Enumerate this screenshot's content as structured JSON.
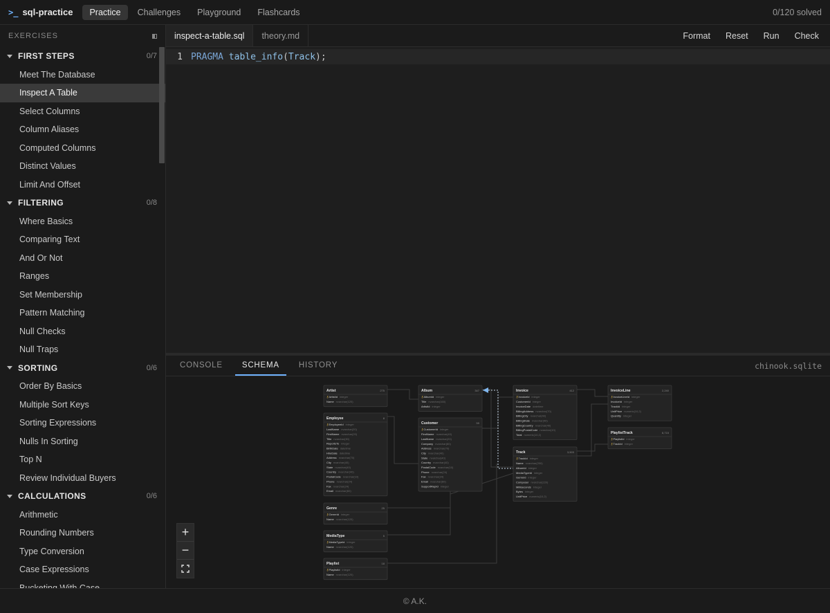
{
  "app": {
    "prompt": ">_",
    "name": "sql-practice",
    "nav": [
      "Practice",
      "Challenges",
      "Playground",
      "Flashcards"
    ],
    "solved": "0/120 solved"
  },
  "sidebar": {
    "title": "EXERCISES",
    "groups": [
      {
        "name": "FIRST STEPS",
        "count": "0/7",
        "items": [
          "Meet The Database",
          "Inspect A Table",
          "Select Columns",
          "Column Aliases",
          "Computed Columns",
          "Distinct Values",
          "Limit And Offset"
        ]
      },
      {
        "name": "FILTERING",
        "count": "0/8",
        "items": [
          "Where Basics",
          "Comparing Text",
          "And Or Not",
          "Ranges",
          "Set Membership",
          "Pattern Matching",
          "Null Checks",
          "Null Traps"
        ]
      },
      {
        "name": "SORTING",
        "count": "0/6",
        "items": [
          "Order By Basics",
          "Multiple Sort Keys",
          "Sorting Expressions",
          "Nulls In Sorting",
          "Top N",
          "Review Individual Buyers"
        ]
      },
      {
        "name": "CALCULATIONS",
        "count": "0/6",
        "items": [
          "Arithmetic",
          "Rounding Numbers",
          "Type Conversion",
          "Case Expressions",
          "Bucketing With Case"
        ]
      }
    ],
    "active_item": "Inspect A Table"
  },
  "editor": {
    "tabs": [
      "inspect-a-table.sql",
      "theory.md"
    ],
    "actions": [
      "Format",
      "Reset",
      "Run",
      "Check"
    ],
    "line_number": "1",
    "code": {
      "kw": "PRAGMA",
      "fn": "table_info",
      "open": "(",
      "arg": "Track",
      "close": ");"
    }
  },
  "panel": {
    "tabs": [
      "CONSOLE",
      "SCHEMA",
      "HISTORY"
    ],
    "database": "chinook.sqlite"
  },
  "schema": {
    "tables": [
      {
        "name": "Artist",
        "count": "275",
        "cols": [
          [
            "ArtistId",
            "integer",
            true
          ],
          [
            "Name",
            "nvarchar(120)",
            false
          ]
        ]
      },
      {
        "name": "Album",
        "count": "347",
        "cols": [
          [
            "AlbumId",
            "integer",
            true
          ],
          [
            "Title",
            "nvarchar(160)",
            false
          ],
          [
            "ArtistId",
            "integer",
            false
          ]
        ]
      },
      {
        "name": "Invoice",
        "count": "412",
        "cols": [
          [
            "InvoiceId",
            "integer",
            true
          ],
          [
            "CustomerId",
            "integer",
            false
          ],
          [
            "InvoiceDate",
            "datetime",
            false
          ],
          [
            "BillingAddress",
            "nvarchar(70)",
            false
          ],
          [
            "BillingCity",
            "nvarchar(40)",
            false
          ],
          [
            "BillingState",
            "nvarchar(40)",
            false
          ],
          [
            "BillingCountry",
            "nvarchar(40)",
            false
          ],
          [
            "BillingPostalCode",
            "nvarchar(10)",
            false
          ],
          [
            "Total",
            "numeric(10,2)",
            false
          ]
        ]
      },
      {
        "name": "InvoiceLine",
        "count": "2,240",
        "cols": [
          [
            "InvoiceLineId",
            "integer",
            true
          ],
          [
            "InvoiceId",
            "integer",
            false
          ],
          [
            "TrackId",
            "integer",
            false
          ],
          [
            "UnitPrice",
            "numeric(10,2)",
            false
          ],
          [
            "Quantity",
            "integer",
            false
          ]
        ]
      },
      {
        "name": "Employee",
        "count": "8",
        "cols": [
          [
            "EmployeeId",
            "integer",
            true
          ],
          [
            "LastName",
            "nvarchar(20)",
            false
          ],
          [
            "FirstName",
            "nvarchar(20)",
            false
          ],
          [
            "Title",
            "nvarchar(30)",
            false
          ],
          [
            "ReportsTo",
            "integer",
            false
          ],
          [
            "BirthDate",
            "datetime",
            false
          ],
          [
            "HireDate",
            "datetime",
            false
          ],
          [
            "Address",
            "nvarchar(70)",
            false
          ],
          [
            "City",
            "nvarchar(40)",
            false
          ],
          [
            "State",
            "nvarchar(40)",
            false
          ],
          [
            "Country",
            "nvarchar(40)",
            false
          ],
          [
            "PostalCode",
            "nvarchar(10)",
            false
          ],
          [
            "Phone",
            "nvarchar(24)",
            false
          ],
          [
            "Fax",
            "nvarchar(24)",
            false
          ],
          [
            "Email",
            "nvarchar(60)",
            false
          ]
        ]
      },
      {
        "name": "Customer",
        "count": "59",
        "cols": [
          [
            "CustomerId",
            "integer",
            true
          ],
          [
            "FirstName",
            "nvarchar(40)",
            false
          ],
          [
            "LastName",
            "nvarchar(20)",
            false
          ],
          [
            "Company",
            "nvarchar(80)",
            false
          ],
          [
            "Address",
            "nvarchar(70)",
            false
          ],
          [
            "City",
            "nvarchar(40)",
            false
          ],
          [
            "State",
            "nvarchar(40)",
            false
          ],
          [
            "Country",
            "nvarchar(40)",
            false
          ],
          [
            "PostalCode",
            "nvarchar(10)",
            false
          ],
          [
            "Phone",
            "nvarchar(24)",
            false
          ],
          [
            "Fax",
            "nvarchar(24)",
            false
          ],
          [
            "Email",
            "nvarchar(60)",
            false
          ],
          [
            "SupportRepId",
            "integer",
            false
          ]
        ]
      },
      {
        "name": "PlaylistTrack",
        "count": "8,715",
        "cols": [
          [
            "PlaylistId",
            "integer",
            true
          ],
          [
            "TrackId",
            "integer",
            true
          ]
        ]
      },
      {
        "name": "Track",
        "count": "3,503",
        "cols": [
          [
            "TrackId",
            "integer",
            true
          ],
          [
            "Name",
            "nvarchar(200)",
            false
          ],
          [
            "AlbumId",
            "integer",
            false
          ],
          [
            "MediaTypeId",
            "integer",
            false
          ],
          [
            "GenreId",
            "integer",
            false
          ],
          [
            "Composer",
            "nvarchar(220)",
            false
          ],
          [
            "Milliseconds",
            "integer",
            false
          ],
          [
            "Bytes",
            "integer",
            false
          ],
          [
            "UnitPrice",
            "numeric(10,2)",
            false
          ]
        ]
      },
      {
        "name": "Genre",
        "count": "25",
        "cols": [
          [
            "GenreId",
            "integer",
            true
          ],
          [
            "Name",
            "nvarchar(120)",
            false
          ]
        ]
      },
      {
        "name": "MediaType",
        "count": "5",
        "cols": [
          [
            "MediaTypeId",
            "integer",
            true
          ],
          [
            "Name",
            "nvarchar(120)",
            false
          ]
        ]
      },
      {
        "name": "Playlist",
        "count": "18",
        "cols": [
          [
            "PlaylistId",
            "integer",
            true
          ],
          [
            "Name",
            "nvarchar(120)",
            false
          ]
        ]
      }
    ]
  },
  "zoom": {
    "in": "+",
    "out": "−"
  },
  "footer": "© A.K."
}
